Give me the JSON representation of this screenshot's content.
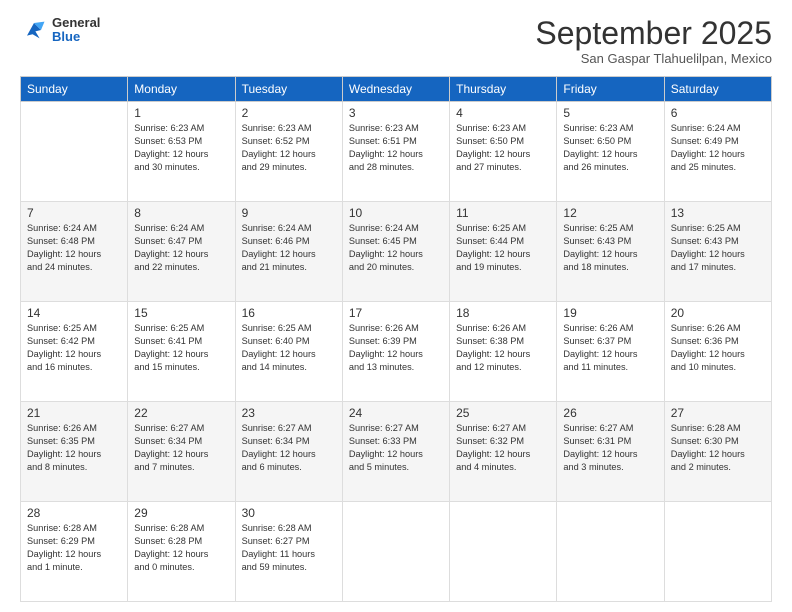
{
  "header": {
    "logo_general": "General",
    "logo_blue": "Blue",
    "month_title": "September 2025",
    "location": "San Gaspar Tlahuelilpan, Mexico"
  },
  "days_of_week": [
    "Sunday",
    "Monday",
    "Tuesday",
    "Wednesday",
    "Thursday",
    "Friday",
    "Saturday"
  ],
  "weeks": [
    [
      {
        "day": "",
        "info": ""
      },
      {
        "day": "1",
        "info": "Sunrise: 6:23 AM\nSunset: 6:53 PM\nDaylight: 12 hours\nand 30 minutes."
      },
      {
        "day": "2",
        "info": "Sunrise: 6:23 AM\nSunset: 6:52 PM\nDaylight: 12 hours\nand 29 minutes."
      },
      {
        "day": "3",
        "info": "Sunrise: 6:23 AM\nSunset: 6:51 PM\nDaylight: 12 hours\nand 28 minutes."
      },
      {
        "day": "4",
        "info": "Sunrise: 6:23 AM\nSunset: 6:50 PM\nDaylight: 12 hours\nand 27 minutes."
      },
      {
        "day": "5",
        "info": "Sunrise: 6:23 AM\nSunset: 6:50 PM\nDaylight: 12 hours\nand 26 minutes."
      },
      {
        "day": "6",
        "info": "Sunrise: 6:24 AM\nSunset: 6:49 PM\nDaylight: 12 hours\nand 25 minutes."
      }
    ],
    [
      {
        "day": "7",
        "info": "Sunrise: 6:24 AM\nSunset: 6:48 PM\nDaylight: 12 hours\nand 24 minutes."
      },
      {
        "day": "8",
        "info": "Sunrise: 6:24 AM\nSunset: 6:47 PM\nDaylight: 12 hours\nand 22 minutes."
      },
      {
        "day": "9",
        "info": "Sunrise: 6:24 AM\nSunset: 6:46 PM\nDaylight: 12 hours\nand 21 minutes."
      },
      {
        "day": "10",
        "info": "Sunrise: 6:24 AM\nSunset: 6:45 PM\nDaylight: 12 hours\nand 20 minutes."
      },
      {
        "day": "11",
        "info": "Sunrise: 6:25 AM\nSunset: 6:44 PM\nDaylight: 12 hours\nand 19 minutes."
      },
      {
        "day": "12",
        "info": "Sunrise: 6:25 AM\nSunset: 6:43 PM\nDaylight: 12 hours\nand 18 minutes."
      },
      {
        "day": "13",
        "info": "Sunrise: 6:25 AM\nSunset: 6:43 PM\nDaylight: 12 hours\nand 17 minutes."
      }
    ],
    [
      {
        "day": "14",
        "info": "Sunrise: 6:25 AM\nSunset: 6:42 PM\nDaylight: 12 hours\nand 16 minutes."
      },
      {
        "day": "15",
        "info": "Sunrise: 6:25 AM\nSunset: 6:41 PM\nDaylight: 12 hours\nand 15 minutes."
      },
      {
        "day": "16",
        "info": "Sunrise: 6:25 AM\nSunset: 6:40 PM\nDaylight: 12 hours\nand 14 minutes."
      },
      {
        "day": "17",
        "info": "Sunrise: 6:26 AM\nSunset: 6:39 PM\nDaylight: 12 hours\nand 13 minutes."
      },
      {
        "day": "18",
        "info": "Sunrise: 6:26 AM\nSunset: 6:38 PM\nDaylight: 12 hours\nand 12 minutes."
      },
      {
        "day": "19",
        "info": "Sunrise: 6:26 AM\nSunset: 6:37 PM\nDaylight: 12 hours\nand 11 minutes."
      },
      {
        "day": "20",
        "info": "Sunrise: 6:26 AM\nSunset: 6:36 PM\nDaylight: 12 hours\nand 10 minutes."
      }
    ],
    [
      {
        "day": "21",
        "info": "Sunrise: 6:26 AM\nSunset: 6:35 PM\nDaylight: 12 hours\nand 8 minutes."
      },
      {
        "day": "22",
        "info": "Sunrise: 6:27 AM\nSunset: 6:34 PM\nDaylight: 12 hours\nand 7 minutes."
      },
      {
        "day": "23",
        "info": "Sunrise: 6:27 AM\nSunset: 6:34 PM\nDaylight: 12 hours\nand 6 minutes."
      },
      {
        "day": "24",
        "info": "Sunrise: 6:27 AM\nSunset: 6:33 PM\nDaylight: 12 hours\nand 5 minutes."
      },
      {
        "day": "25",
        "info": "Sunrise: 6:27 AM\nSunset: 6:32 PM\nDaylight: 12 hours\nand 4 minutes."
      },
      {
        "day": "26",
        "info": "Sunrise: 6:27 AM\nSunset: 6:31 PM\nDaylight: 12 hours\nand 3 minutes."
      },
      {
        "day": "27",
        "info": "Sunrise: 6:28 AM\nSunset: 6:30 PM\nDaylight: 12 hours\nand 2 minutes."
      }
    ],
    [
      {
        "day": "28",
        "info": "Sunrise: 6:28 AM\nSunset: 6:29 PM\nDaylight: 12 hours\nand 1 minute."
      },
      {
        "day": "29",
        "info": "Sunrise: 6:28 AM\nSunset: 6:28 PM\nDaylight: 12 hours\nand 0 minutes."
      },
      {
        "day": "30",
        "info": "Sunrise: 6:28 AM\nSunset: 6:27 PM\nDaylight: 11 hours\nand 59 minutes."
      },
      {
        "day": "",
        "info": ""
      },
      {
        "day": "",
        "info": ""
      },
      {
        "day": "",
        "info": ""
      },
      {
        "day": "",
        "info": ""
      }
    ]
  ]
}
